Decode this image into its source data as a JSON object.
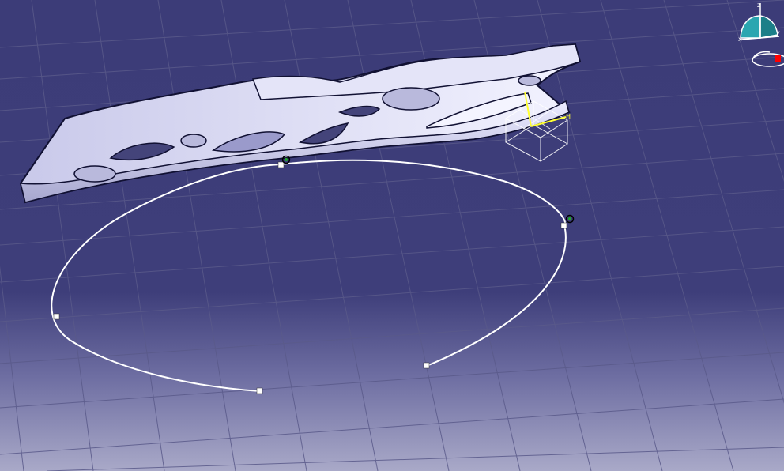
{
  "viewport": {
    "background_top": "#3c3c78",
    "background_bottom": "#a9a9c8",
    "grid_color": "#5c5c8c"
  },
  "part": {
    "fill": "#d8d8f0",
    "edge": "#111133"
  },
  "sketch_curve": {
    "color": "#ffffff",
    "control_points": 6
  },
  "axis_system": {
    "color": "#ffff33",
    "label": "H"
  },
  "compass": {
    "x_label": "x",
    "y_label": "y",
    "z_label": "z",
    "face_color": "#2aa6b0",
    "accent_color": "#ff0000"
  }
}
